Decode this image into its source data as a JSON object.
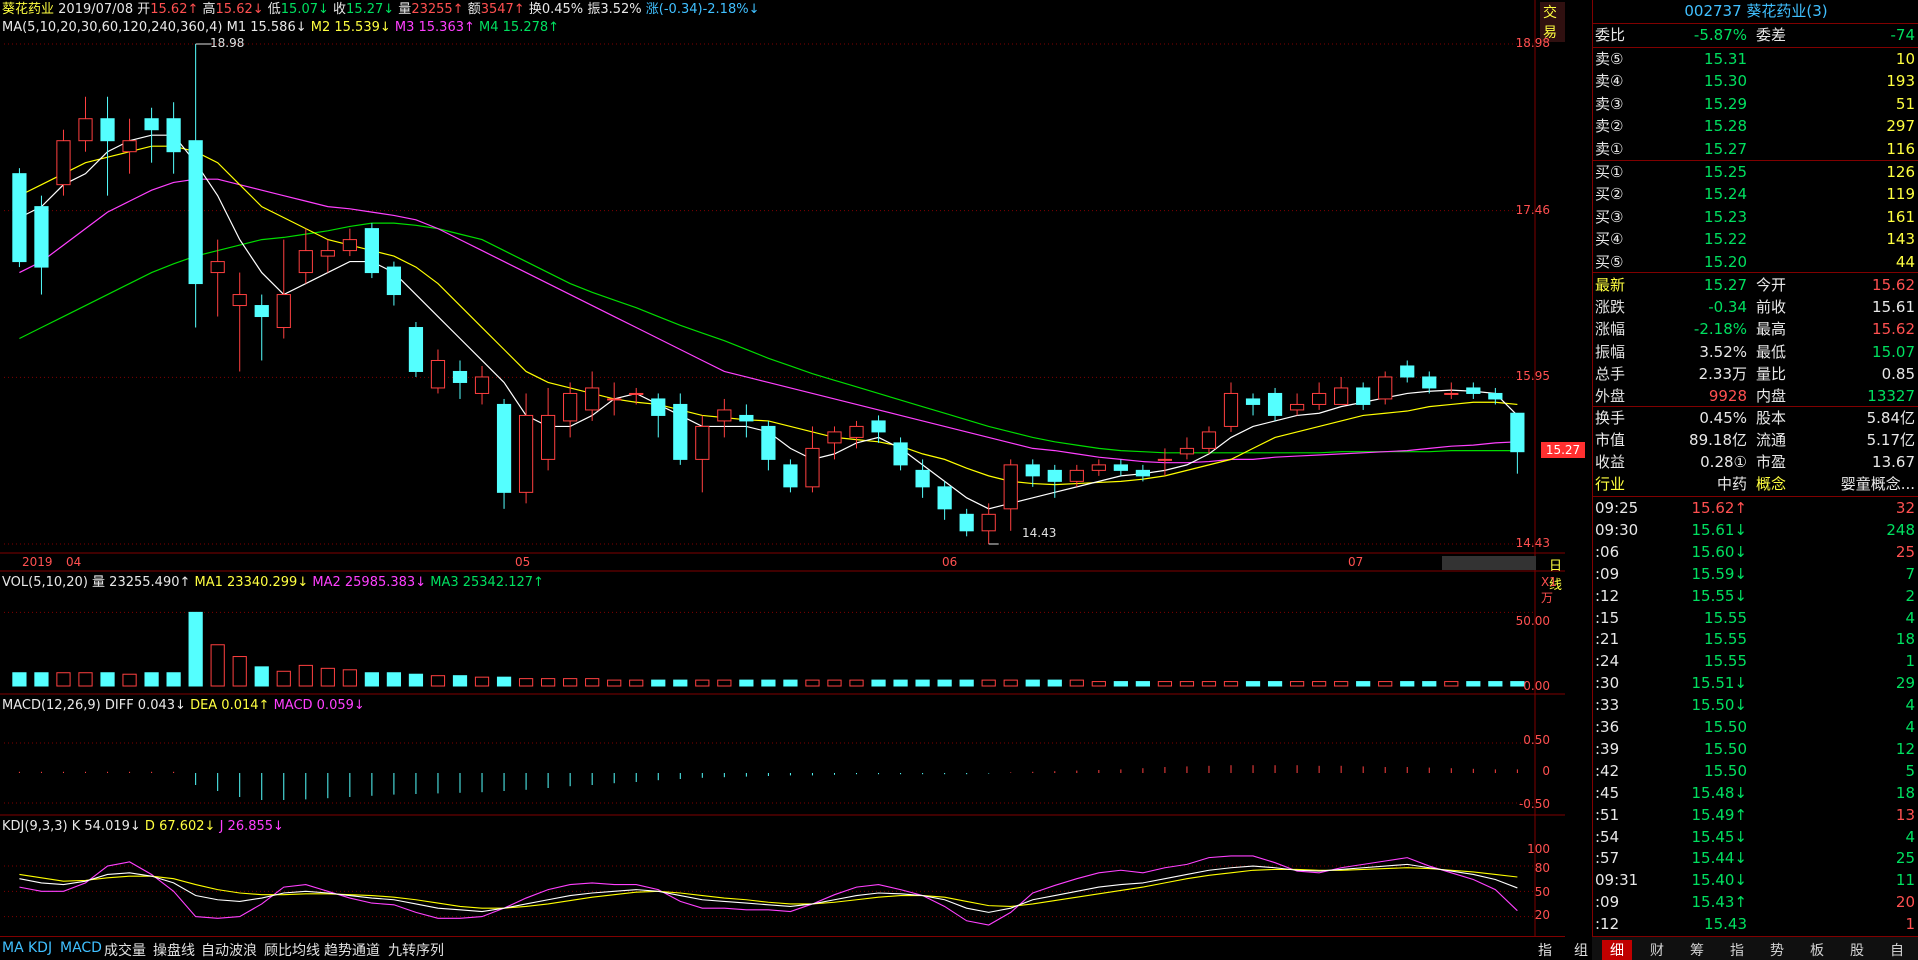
{
  "stock": {
    "name": "葵花药业",
    "date": "2019/07/08",
    "code_title": "002737 葵花药业(3)"
  },
  "header": {
    "open_label": "开",
    "open": "15.62↑",
    "high_label": "高",
    "high": "15.62↓",
    "low_label": "低",
    "low": "15.07↓",
    "close_label": "收",
    "close": "15.27↓",
    "vol_label": "量",
    "vol": "23255↑",
    "amt_label": "额",
    "amt": "3547↑",
    "turnover_label": "换",
    "turnover": "0.45%",
    "amp_label": "振",
    "amp": "3.52%",
    "chg_label": "涨",
    "chg": "(-0.34)-2.18%↓",
    "trade_btn": "交易",
    "ma_params": "MA(5,10,20,30,60,120,240,360,4)",
    "m1": "M1 15.586↓",
    "m2": "M2 15.539↓",
    "m3": "M3 15.363↑",
    "m4": "M4 15.278↑"
  },
  "colors": {
    "up": "#ff4040",
    "down": "#54ffff",
    "ma1": "#ffffff",
    "ma2": "#ffff00",
    "ma3": "#ff40ff",
    "ma4": "#00dd00",
    "grid": "#800000"
  },
  "price_axis": {
    "labels": [
      "18.98",
      "17.46",
      "15.95",
      "14.43"
    ],
    "current": "15.27",
    "max_mark": "18.98",
    "min_mark": "14.43",
    "period": "日线"
  },
  "date_axis": {
    "labels": [
      "2019",
      "04",
      "05",
      "06",
      "07"
    ]
  },
  "vol_panel": {
    "title": "VOL(5,10,20)",
    "vol": "量 23255.490↑",
    "ma1": "MA1 23340.299↓",
    "ma2": "MA2 25985.383↓",
    "ma3": "MA3 25342.127↑",
    "unit": "X1万",
    "labels": [
      "50.00",
      "0.00"
    ]
  },
  "macd_panel": {
    "title": "MACD(12,26,9)",
    "diff": "DIFF 0.043↓",
    "dea": "DEA 0.014↑",
    "macd": "MACD 0.059↓",
    "labels": [
      "0.50",
      "0",
      "-0.50"
    ]
  },
  "kdj_panel": {
    "title": "KDJ(9,3,3)",
    "k": "K 54.019↓",
    "d": "D 67.602↓",
    "j": "J 26.855↓",
    "labels": [
      "100",
      "80",
      "50",
      "20"
    ]
  },
  "bottom_tabs": [
    "MA",
    "KDJ",
    "MACD",
    "成交量",
    "操盘线",
    "自动波浪",
    "顾比均线",
    "趋势通道",
    "九转序列"
  ],
  "bottom_right": [
    "指",
    "组"
  ],
  "right_tabs": [
    "细",
    "财",
    "筹",
    "指",
    "势",
    "板",
    "股",
    "自"
  ],
  "chart_data": {
    "type": "candlestick",
    "ylim": [
      14.43,
      18.98
    ],
    "candles": [
      [
        17.8,
        17.0,
        17.85,
        16.95
      ],
      [
        17.5,
        16.95,
        17.6,
        16.7
      ],
      [
        17.7,
        18.1,
        18.2,
        17.6
      ],
      [
        18.1,
        18.3,
        18.5,
        18.0
      ],
      [
        18.3,
        18.1,
        18.5,
        17.6
      ],
      [
        18.0,
        18.1,
        18.3,
        17.8
      ],
      [
        18.3,
        18.2,
        18.4,
        17.9
      ],
      [
        18.3,
        18.0,
        18.45,
        17.8
      ],
      [
        18.1,
        16.8,
        18.98,
        16.4
      ],
      [
        16.9,
        17.0,
        17.2,
        16.5
      ],
      [
        16.6,
        16.7,
        16.9,
        16.0
      ],
      [
        16.6,
        16.5,
        16.7,
        16.1
      ],
      [
        16.4,
        16.7,
        17.2,
        16.3
      ],
      [
        16.9,
        17.1,
        17.3,
        16.8
      ],
      [
        17.05,
        17.1,
        17.2,
        16.9
      ],
      [
        17.1,
        17.2,
        17.3,
        17.05
      ],
      [
        17.3,
        16.9,
        17.35,
        16.85
      ],
      [
        16.95,
        16.7,
        17.0,
        16.6
      ],
      [
        16.4,
        16.0,
        16.45,
        15.95
      ],
      [
        15.85,
        16.1,
        16.2,
        15.8
      ],
      [
        16.0,
        15.9,
        16.1,
        15.75
      ],
      [
        15.8,
        15.95,
        16.05,
        15.7
      ],
      [
        15.7,
        14.9,
        15.75,
        14.75
      ],
      [
        14.9,
        15.6,
        15.8,
        14.8
      ],
      [
        15.2,
        15.6,
        15.85,
        15.1
      ],
      [
        15.55,
        15.8,
        15.9,
        15.4
      ],
      [
        15.65,
        15.85,
        16.0,
        15.55
      ],
      [
        15.75,
        15.75,
        15.9,
        15.6
      ],
      [
        15.8,
        15.8,
        15.85,
        15.7
      ],
      [
        15.75,
        15.6,
        15.8,
        15.4
      ],
      [
        15.7,
        15.2,
        15.8,
        15.15
      ],
      [
        15.2,
        15.5,
        15.6,
        14.9
      ],
      [
        15.55,
        15.65,
        15.75,
        15.4
      ],
      [
        15.6,
        15.55,
        15.7,
        15.4
      ],
      [
        15.5,
        15.2,
        15.55,
        15.1
      ],
      [
        15.15,
        14.95,
        15.2,
        14.9
      ],
      [
        14.95,
        15.3,
        15.5,
        14.9
      ],
      [
        15.35,
        15.45,
        15.5,
        15.2
      ],
      [
        15.4,
        15.5,
        15.55,
        15.3
      ],
      [
        15.55,
        15.45,
        15.6,
        15.35
      ],
      [
        15.35,
        15.15,
        15.4,
        15.1
      ],
      [
        15.1,
        14.95,
        15.2,
        14.85
      ],
      [
        14.95,
        14.75,
        15.0,
        14.65
      ],
      [
        14.7,
        14.55,
        14.75,
        14.5
      ],
      [
        14.55,
        14.7,
        14.8,
        14.43
      ],
      [
        14.75,
        15.15,
        15.2,
        14.55
      ],
      [
        15.15,
        15.05,
        15.2,
        14.95
      ],
      [
        15.1,
        15.0,
        15.15,
        14.85
      ],
      [
        15.0,
        15.1,
        15.15,
        14.95
      ],
      [
        15.1,
        15.15,
        15.2,
        15.05
      ],
      [
        15.15,
        15.1,
        15.2,
        15.05
      ],
      [
        15.1,
        15.05,
        15.15,
        15.0
      ],
      [
        15.2,
        15.2,
        15.3,
        15.05
      ],
      [
        15.25,
        15.3,
        15.4,
        15.2
      ],
      [
        15.3,
        15.45,
        15.5,
        15.25
      ],
      [
        15.5,
        15.8,
        15.9,
        15.45
      ],
      [
        15.75,
        15.7,
        15.8,
        15.6
      ],
      [
        15.8,
        15.6,
        15.85,
        15.55
      ],
      [
        15.65,
        15.7,
        15.8,
        15.6
      ],
      [
        15.7,
        15.8,
        15.9,
        15.65
      ],
      [
        15.7,
        15.85,
        15.95,
        15.7
      ],
      [
        15.85,
        15.7,
        15.9,
        15.65
      ],
      [
        15.75,
        15.95,
        16.0,
        15.7
      ],
      [
        16.05,
        15.95,
        16.1,
        15.9
      ],
      [
        15.95,
        15.85,
        16.0,
        15.8
      ],
      [
        15.8,
        15.8,
        15.9,
        15.75
      ],
      [
        15.85,
        15.8,
        15.9,
        15.75
      ],
      [
        15.8,
        15.75,
        15.85,
        15.7
      ],
      [
        15.62,
        15.27,
        15.62,
        15.07
      ]
    ],
    "ma1": [
      17.4,
      17.5,
      17.7,
      17.8,
      18.0,
      18.1,
      18.15,
      18.15,
      17.9,
      17.6,
      17.2,
      16.9,
      16.7,
      16.8,
      16.9,
      17.0,
      17.0,
      16.9,
      16.7,
      16.5,
      16.3,
      16.1,
      15.9,
      15.6,
      15.5,
      15.5,
      15.6,
      15.75,
      15.8,
      15.7,
      15.6,
      15.5,
      15.5,
      15.5,
      15.45,
      15.3,
      15.2,
      15.25,
      15.35,
      15.4,
      15.3,
      15.15,
      15.0,
      14.85,
      14.75,
      14.8,
      14.85,
      14.9,
      14.95,
      15.0,
      15.05,
      15.07,
      15.1,
      15.15,
      15.25,
      15.4,
      15.5,
      15.55,
      15.6,
      15.62,
      15.68,
      15.72,
      15.76,
      15.8,
      15.82,
      15.83,
      15.82,
      15.8,
      15.6
    ],
    "ma2": [
      17.6,
      17.7,
      17.8,
      17.9,
      17.95,
      18.0,
      18.05,
      18.05,
      18.0,
      17.9,
      17.7,
      17.5,
      17.4,
      17.3,
      17.2,
      17.15,
      17.1,
      17.05,
      16.95,
      16.8,
      16.6,
      16.4,
      16.2,
      16.0,
      15.9,
      15.85,
      15.8,
      15.75,
      15.72,
      15.7,
      15.65,
      15.6,
      15.58,
      15.56,
      15.55,
      15.5,
      15.45,
      15.4,
      15.38,
      15.36,
      15.32,
      15.25,
      15.2,
      15.12,
      15.05,
      15.0,
      14.98,
      14.97,
      14.98,
      14.99,
      15.0,
      15.02,
      15.05,
      15.1,
      15.15,
      15.2,
      15.3,
      15.4,
      15.45,
      15.5,
      15.55,
      15.6,
      15.62,
      15.64,
      15.68,
      15.7,
      15.72,
      15.72,
      15.7
    ],
    "ma3": [
      16.9,
      17.0,
      17.15,
      17.3,
      17.45,
      17.55,
      17.65,
      17.72,
      17.75,
      17.75,
      17.7,
      17.65,
      17.6,
      17.55,
      17.5,
      17.48,
      17.45,
      17.42,
      17.38,
      17.3,
      17.2,
      17.1,
      17.0,
      16.9,
      16.8,
      16.7,
      16.6,
      16.5,
      16.4,
      16.3,
      16.2,
      16.1,
      16.0,
      15.95,
      15.9,
      15.85,
      15.8,
      15.75,
      15.7,
      15.65,
      15.6,
      15.55,
      15.5,
      15.45,
      15.4,
      15.35,
      15.3,
      15.28,
      15.25,
      15.22,
      15.2,
      15.18,
      15.17,
      15.17,
      15.18,
      15.2,
      15.2,
      15.22,
      15.23,
      15.24,
      15.25,
      15.26,
      15.27,
      15.28,
      15.3,
      15.32,
      15.33,
      15.35,
      15.36
    ],
    "ma4": [
      16.3,
      16.4,
      16.5,
      16.6,
      16.7,
      16.8,
      16.9,
      16.98,
      17.05,
      17.1,
      17.15,
      17.2,
      17.22,
      17.25,
      17.28,
      17.32,
      17.35,
      17.35,
      17.33,
      17.3,
      17.25,
      17.2,
      17.1,
      17.0,
      16.9,
      16.8,
      16.72,
      16.65,
      16.58,
      16.5,
      16.42,
      16.35,
      16.28,
      16.2,
      16.12,
      16.05,
      15.98,
      15.92,
      15.86,
      15.8,
      15.74,
      15.68,
      15.62,
      15.56,
      15.5,
      15.45,
      15.4,
      15.36,
      15.33,
      15.3,
      15.28,
      15.27,
      15.26,
      15.26,
      15.26,
      15.26,
      15.26,
      15.26,
      15.26,
      15.26,
      15.27,
      15.27,
      15.27,
      15.27,
      15.27,
      15.28,
      15.28,
      15.28,
      15.28
    ],
    "volume": [
      9,
      9,
      9,
      9,
      9,
      8,
      9,
      9,
      50,
      28,
      20,
      13,
      10,
      14,
      12,
      11,
      9,
      9,
      8,
      7,
      7,
      6,
      6,
      5,
      5,
      5,
      5,
      4,
      4,
      4,
      4,
      4,
      4,
      4,
      4,
      4,
      4,
      4,
      4,
      4,
      4,
      4,
      4,
      4,
      4,
      4,
      4,
      4,
      4,
      3,
      3,
      3,
      3,
      3,
      3,
      3,
      3,
      3,
      3,
      3,
      3,
      3,
      3,
      3,
      3,
      3,
      3,
      3,
      3
    ],
    "macd_hist": [
      0.02,
      0.02,
      0.02,
      0.02,
      0.02,
      0.02,
      0.02,
      0.02,
      -0.2,
      -0.3,
      -0.4,
      -0.45,
      -0.45,
      -0.44,
      -0.42,
      -0.4,
      -0.38,
      -0.36,
      -0.35,
      -0.34,
      -0.33,
      -0.32,
      -0.3,
      -0.28,
      -0.25,
      -0.22,
      -0.2,
      -0.17,
      -0.15,
      -0.12,
      -0.1,
      -0.08,
      -0.07,
      -0.06,
      -0.05,
      -0.04,
      -0.04,
      -0.03,
      -0.02,
      -0.02,
      -0.02,
      -0.02,
      -0.02,
      -0.02,
      -0.01,
      0.01,
      0.02,
      0.03,
      0.04,
      0.05,
      0.06,
      0.08,
      0.1,
      0.11,
      0.12,
      0.13,
      0.13,
      0.13,
      0.13,
      0.12,
      0.12,
      0.11,
      0.1,
      0.1,
      0.09,
      0.08,
      0.07,
      0.06,
      0.06
    ],
    "kdj_k": [
      65,
      60,
      58,
      62,
      70,
      72,
      68,
      60,
      45,
      40,
      38,
      42,
      48,
      50,
      48,
      45,
      42,
      40,
      35,
      30,
      28,
      26,
      30,
      35,
      40,
      45,
      48,
      50,
      52,
      50,
      45,
      40,
      38,
      36,
      34,
      32,
      35,
      40,
      45,
      48,
      47,
      45,
      40,
      30,
      25,
      30,
      40,
      45,
      50,
      55,
      58,
      60,
      65,
      70,
      75,
      78,
      80,
      78,
      75,
      74,
      76,
      78,
      80,
      82,
      78,
      74,
      70,
      64,
      54
    ],
    "kdj_d": [
      70,
      66,
      62,
      63,
      66,
      68,
      68,
      65,
      58,
      52,
      48,
      46,
      46,
      47,
      47,
      46,
      45,
      43,
      40,
      36,
      32,
      30,
      30,
      32,
      35,
      39,
      43,
      46,
      49,
      50,
      48,
      45,
      42,
      40,
      37,
      35,
      35,
      37,
      40,
      43,
      45,
      45,
      43,
      38,
      33,
      32,
      35,
      39,
      43,
      47,
      51,
      55,
      60,
      65,
      69,
      72,
      75,
      76,
      76,
      75,
      75,
      76,
      77,
      78,
      77,
      75,
      73,
      70,
      67
    ],
    "kdj_j": [
      55,
      50,
      50,
      60,
      80,
      85,
      70,
      50,
      20,
      18,
      20,
      35,
      55,
      58,
      50,
      42,
      36,
      34,
      25,
      18,
      18,
      20,
      30,
      42,
      52,
      58,
      60,
      58,
      58,
      52,
      38,
      30,
      30,
      28,
      28,
      26,
      35,
      46,
      55,
      58,
      52,
      45,
      32,
      15,
      10,
      25,
      48,
      57,
      65,
      72,
      75,
      72,
      78,
      82,
      90,
      92,
      92,
      84,
      74,
      72,
      78,
      82,
      86,
      90,
      80,
      72,
      64,
      52,
      27
    ]
  },
  "ladder": {
    "weibi": {
      "label": "委比",
      "value": "-5.87%",
      "label2": "委差",
      "value2": "-74"
    },
    "asks": [
      {
        "label": "卖⑤",
        "price": "15.31",
        "vol": "10"
      },
      {
        "label": "卖④",
        "price": "15.30",
        "vol": "193"
      },
      {
        "label": "卖③",
        "price": "15.29",
        "vol": "51"
      },
      {
        "label": "卖②",
        "price": "15.28",
        "vol": "297"
      },
      {
        "label": "卖①",
        "price": "15.27",
        "vol": "116"
      }
    ],
    "bids": [
      {
        "label": "买①",
        "price": "15.25",
        "vol": "126"
      },
      {
        "label": "买②",
        "price": "15.24",
        "vol": "119"
      },
      {
        "label": "买③",
        "price": "15.23",
        "vol": "161"
      },
      {
        "label": "买④",
        "price": "15.22",
        "vol": "143"
      },
      {
        "label": "买⑤",
        "price": "15.20",
        "vol": "44"
      }
    ]
  },
  "quote": [
    {
      "l1": "最新",
      "v1": "15.27",
      "c1": "green",
      "l2": "今开",
      "v2": "15.62",
      "c2": "red"
    },
    {
      "l1": "涨跌",
      "v1": "-0.34",
      "c1": "green",
      "l2": "前收",
      "v2": "15.61",
      "c2": "white"
    },
    {
      "l1": "涨幅",
      "v1": "-2.18%",
      "c1": "green",
      "l2": "最高",
      "v2": "15.62",
      "c2": "red"
    },
    {
      "l1": "振幅",
      "v1": "3.52%",
      "c1": "white",
      "l2": "最低",
      "v2": "15.07",
      "c2": "green"
    },
    {
      "l1": "总手",
      "v1": "2.33万",
      "c1": "white",
      "l2": "量比",
      "v2": "0.85",
      "c2": "white"
    },
    {
      "l1": "外盘",
      "v1": "9928",
      "c1": "red",
      "l2": "内盘",
      "v2": "13327",
      "c2": "green"
    }
  ],
  "fundamentals": [
    {
      "l1": "换手",
      "v1": "0.45%",
      "l2": "股本",
      "v2": "5.84亿"
    },
    {
      "l1": "市值",
      "v1": "89.18亿",
      "l2": "流通",
      "v2": "5.17亿"
    },
    {
      "l1": "收益",
      "v1": "0.28①",
      "l2": "市盈",
      "v2": "13.67"
    }
  ],
  "industry": {
    "label": "行业",
    "value": "中药",
    "label2": "概念",
    "value2": "婴童概念..."
  },
  "ticks": [
    {
      "t": "09:25",
      "p": "15.62↑",
      "pc": "red",
      "v": "32",
      "vc": "red"
    },
    {
      "t": "09:30",
      "p": "15.61↓",
      "pc": "green",
      "v": "248",
      "vc": "green"
    },
    {
      "t": ":06",
      "p": "15.60↓",
      "pc": "green",
      "v": "25",
      "vc": "red"
    },
    {
      "t": ":09",
      "p": "15.59↓",
      "pc": "green",
      "v": "7",
      "vc": "green"
    },
    {
      "t": ":12",
      "p": "15.55↓",
      "pc": "green",
      "v": "2",
      "vc": "green"
    },
    {
      "t": ":15",
      "p": "15.55",
      "pc": "green",
      "v": "4",
      "vc": "green"
    },
    {
      "t": ":21",
      "p": "15.55",
      "pc": "green",
      "v": "18",
      "vc": "green"
    },
    {
      "t": ":24",
      "p": "15.55",
      "pc": "green",
      "v": "1",
      "vc": "green"
    },
    {
      "t": ":30",
      "p": "15.51↓",
      "pc": "green",
      "v": "29",
      "vc": "green"
    },
    {
      "t": ":33",
      "p": "15.50↓",
      "pc": "green",
      "v": "4",
      "vc": "green"
    },
    {
      "t": ":36",
      "p": "15.50",
      "pc": "green",
      "v": "4",
      "vc": "green"
    },
    {
      "t": ":39",
      "p": "15.50",
      "pc": "green",
      "v": "12",
      "vc": "green"
    },
    {
      "t": ":42",
      "p": "15.50",
      "pc": "green",
      "v": "5",
      "vc": "green"
    },
    {
      "t": ":45",
      "p": "15.48↓",
      "pc": "green",
      "v": "18",
      "vc": "green"
    },
    {
      "t": ":51",
      "p": "15.49↑",
      "pc": "green",
      "v": "13",
      "vc": "red"
    },
    {
      "t": ":54",
      "p": "15.45↓",
      "pc": "green",
      "v": "4",
      "vc": "green"
    },
    {
      "t": ":57",
      "p": "15.44↓",
      "pc": "green",
      "v": "25",
      "vc": "green"
    },
    {
      "t": "09:31",
      "p": "15.40↓",
      "pc": "green",
      "v": "11",
      "vc": "green"
    },
    {
      "t": ":09",
      "p": "15.43↑",
      "pc": "green",
      "v": "20",
      "vc": "red"
    },
    {
      "t": ":12",
      "p": "15.43",
      "pc": "green",
      "v": "1",
      "vc": "red"
    }
  ]
}
